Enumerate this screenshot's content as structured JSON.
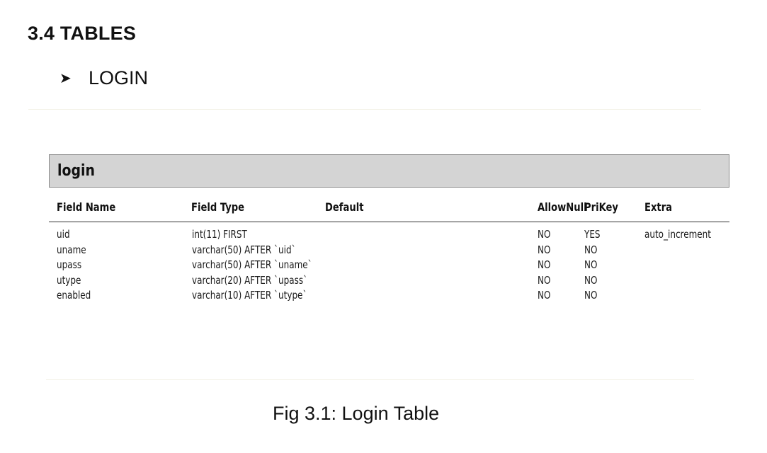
{
  "section": {
    "heading": "3.4 TABLES",
    "bullet": "LOGIN"
  },
  "table": {
    "name": "login",
    "columns": {
      "field_name": "Field Name",
      "field_type": "Field Type",
      "default": "Default",
      "allow_null": "AllowNull",
      "pri_key": "PriKey",
      "extra": "Extra"
    },
    "rows": [
      {
        "field_name": "uid",
        "field_type": "int(11) FIRST",
        "default": "",
        "allow_null": "NO",
        "pri_key": "YES",
        "extra": "auto_increment"
      },
      {
        "field_name": "uname",
        "field_type": "varchar(50) AFTER `uid`",
        "default": "",
        "allow_null": "NO",
        "pri_key": "NO",
        "extra": ""
      },
      {
        "field_name": "upass",
        "field_type": "varchar(50) AFTER `uname`",
        "default": "",
        "allow_null": "NO",
        "pri_key": "NO",
        "extra": ""
      },
      {
        "field_name": "utype",
        "field_type": "varchar(20) AFTER `upass`",
        "default": "",
        "allow_null": "NO",
        "pri_key": "NO",
        "extra": ""
      },
      {
        "field_name": "enabled",
        "field_type": "varchar(10) AFTER `utype`",
        "default": "",
        "allow_null": "NO",
        "pri_key": "NO",
        "extra": ""
      }
    ]
  },
  "caption": "Fig 3.1: Login Table"
}
